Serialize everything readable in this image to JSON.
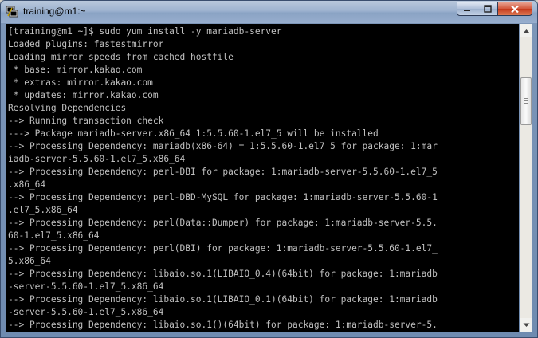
{
  "window": {
    "title": "training@m1:~"
  },
  "controls": {
    "minimize_icon": "minimize-icon",
    "maximize_icon": "maximize-icon",
    "close_icon": "close-icon"
  },
  "terminal": {
    "lines": [
      "[training@m1 ~]$ sudo yum install -y mariadb-server",
      "Loaded plugins: fastestmirror",
      "Loading mirror speeds from cached hostfile",
      " * base: mirror.kakao.com",
      " * extras: mirror.kakao.com",
      " * updates: mirror.kakao.com",
      "Resolving Dependencies",
      "--> Running transaction check",
      "---> Package mariadb-server.x86_64 1:5.5.60-1.el7_5 will be installed",
      "--> Processing Dependency: mariadb(x86-64) = 1:5.5.60-1.el7_5 for package: 1:mar",
      "iadb-server-5.5.60-1.el7_5.x86_64",
      "--> Processing Dependency: perl-DBI for package: 1:mariadb-server-5.5.60-1.el7_5",
      ".x86_64",
      "--> Processing Dependency: perl-DBD-MySQL for package: 1:mariadb-server-5.5.60-1",
      ".el7_5.x86_64",
      "--> Processing Dependency: perl(Data::Dumper) for package: 1:mariadb-server-5.5.",
      "60-1.el7_5.x86_64",
      "--> Processing Dependency: perl(DBI) for package: 1:mariadb-server-5.5.60-1.el7_",
      "5.x86_64",
      "--> Processing Dependency: libaio.so.1(LIBAIO_0.4)(64bit) for package: 1:mariadb",
      "-server-5.5.60-1.el7_5.x86_64",
      "--> Processing Dependency: libaio.so.1(LIBAIO_0.1)(64bit) for package: 1:mariadb",
      "-server-5.5.60-1.el7_5.x86_64",
      "--> Processing Dependency: libaio.so.1()(64bit) for package: 1:mariadb-server-5."
    ]
  }
}
